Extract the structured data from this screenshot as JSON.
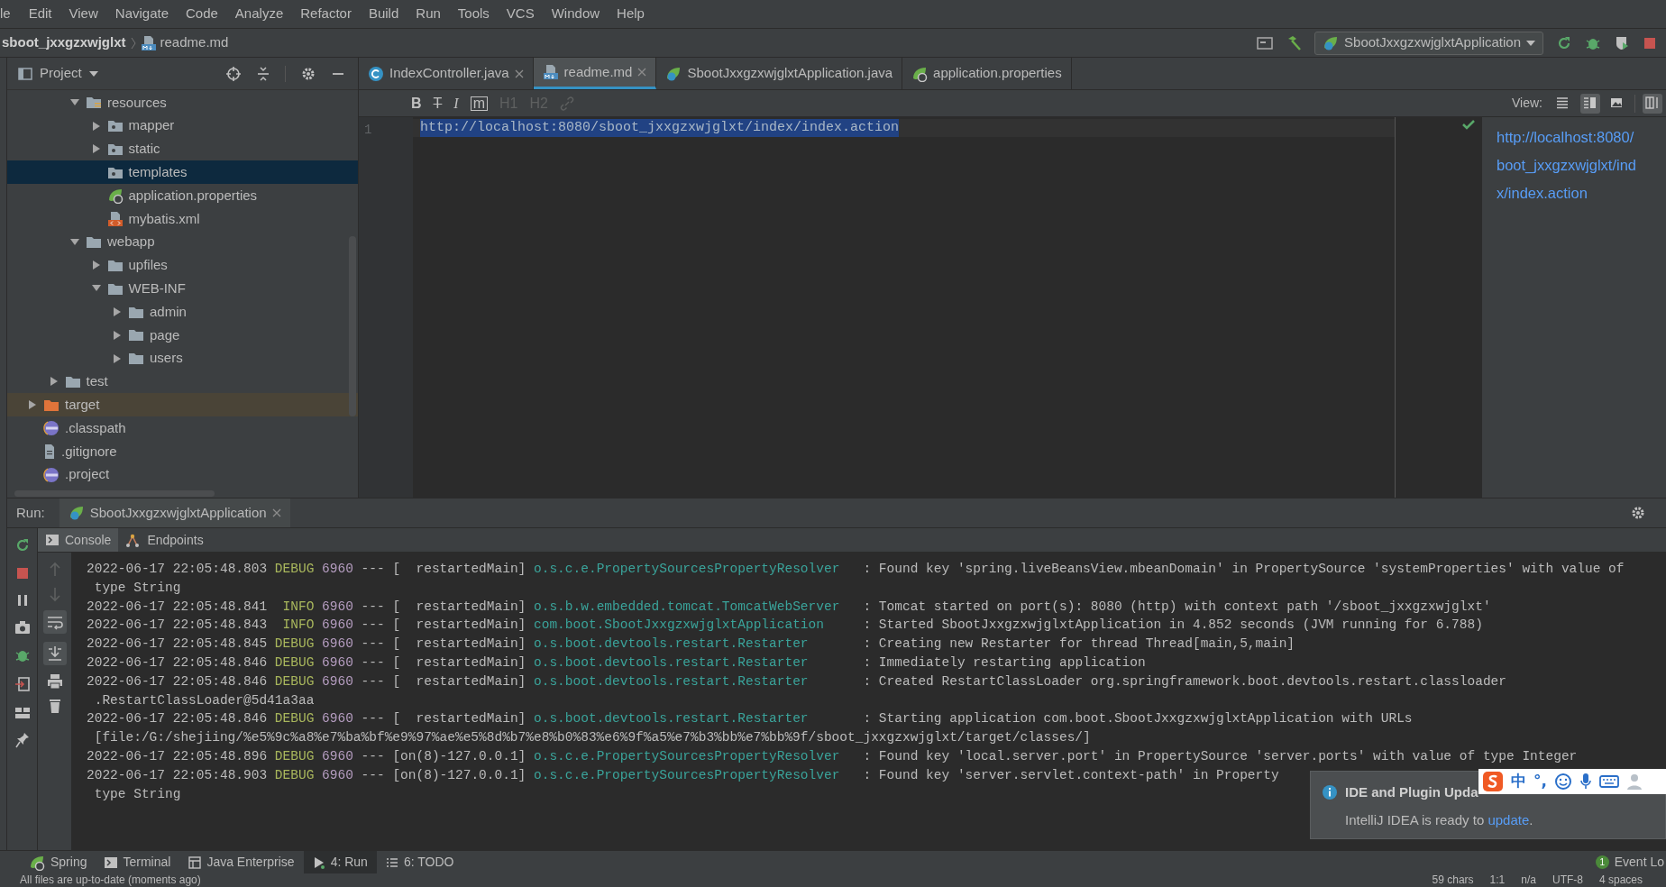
{
  "menu": [
    "le",
    "Edit",
    "View",
    "Navigate",
    "Code",
    "Analyze",
    "Refactor",
    "Build",
    "Run",
    "Tools",
    "VCS",
    "Window",
    "Help"
  ],
  "breadcrumbs": [
    {
      "label": "sboot_jxxgzxwjglxt",
      "kind": "project"
    },
    {
      "label": "readme.md",
      "kind": "markdown"
    }
  ],
  "run_config": {
    "label": "SbootJxxgzxwjglxtApplication"
  },
  "project_panel": {
    "title": "Project",
    "tree": [
      {
        "children": [
          {
            "children": [
              {
                "name": "resources",
                "kind": "resources_folder",
                "expanded": true,
                "selected": false,
                "children": [
                  {
                    "name": "mapper",
                    "kind": "source_folder",
                    "expanded": false,
                    "selected": false
                  },
                  {
                    "name": "static",
                    "kind": "source_folder",
                    "expanded": false,
                    "selected": false
                  },
                  {
                    "name": "templates",
                    "kind": "source_folder",
                    "selected": true
                  },
                  {
                    "name": "application.properties",
                    "kind": "spring",
                    "selected": false
                  },
                  {
                    "name": "mybatis.xml",
                    "kind": "xml",
                    "selected": false
                  }
                ]
              },
              {
                "name": "webapp",
                "kind": "folder",
                "expanded": true,
                "selected": false,
                "children": [
                  {
                    "name": "upfiles",
                    "kind": "folder",
                    "expanded": false,
                    "selected": false
                  },
                  {
                    "name": "WEB-INF",
                    "kind": "folder",
                    "expanded": true,
                    "selected": false,
                    "children": [
                      {
                        "name": "admin",
                        "kind": "folder",
                        "expanded": false,
                        "selected": false
                      },
                      {
                        "name": "page",
                        "kind": "folder",
                        "expanded": false,
                        "selected": false
                      },
                      {
                        "name": "users",
                        "kind": "folder",
                        "expanded": false,
                        "selected": false
                      }
                    ]
                  }
                ]
              }
            ]
          },
          {
            "name": "test",
            "kind": "folder",
            "expanded": false,
            "selected": false
          }
        ]
      },
      {
        "name": "target",
        "kind": "excluded_folder",
        "expanded": false,
        "selected": false
      },
      {
        "name": ".classpath",
        "kind": "eclipse",
        "selected": false
      },
      {
        "name": ".gitignore",
        "kind": "file",
        "selected": false
      },
      {
        "name": ".project",
        "kind": "eclipse",
        "selected": false
      }
    ]
  },
  "editor_tabs": [
    {
      "label": "IndexController.java",
      "kind": "java_class",
      "selected": false,
      "closable": true
    },
    {
      "label": "readme.md",
      "kind": "markdown",
      "selected": true,
      "closable": true
    },
    {
      "label": "SbootJxxgzxwjglxtApplication.java",
      "kind": "spring_app",
      "selected": false,
      "closable": false
    },
    {
      "label": "application.properties",
      "kind": "spring",
      "selected": false,
      "closable": false
    }
  ],
  "format_buttons": [
    {
      "label": "B",
      "kind": "bold",
      "disabled": false
    },
    {
      "label": "T",
      "kind": "strike",
      "disabled": false
    },
    {
      "label": "I",
      "kind": "italic",
      "disabled": false
    },
    {
      "label": "m",
      "kind": "code",
      "disabled": false
    },
    {
      "label": "H1",
      "kind": "heading",
      "disabled": true
    },
    {
      "label": "H2",
      "kind": "heading",
      "disabled": true
    },
    {
      "kind": "link",
      "disabled": true
    }
  ],
  "view_label": "View:",
  "view_modes": [
    {
      "kind": "editor",
      "selected": false
    },
    {
      "kind": "split",
      "selected": true
    },
    {
      "kind": "preview",
      "selected": false
    },
    {
      "kind": "layout",
      "selected": true
    }
  ],
  "editor": {
    "lines": [
      {
        "number": "1",
        "text": "http://localhost:8080/sboot_jxxgzxwjglxt/index/index.action",
        "selected": true
      }
    ]
  },
  "preview": {
    "lines": [
      "http://localhost:8080/",
      "boot_jxxgzxwjglxt/ind",
      "x/index.action"
    ]
  },
  "run_panel": {
    "label": "Run:",
    "tab": "SbootJxxgzxwjglxtApplication",
    "console_tabs": [
      {
        "label": "Console",
        "kind": "console",
        "selected": true
      },
      {
        "label": "Endpoints",
        "kind": "endpoints",
        "selected": false
      }
    ],
    "log": [
      {
        "kind": "entry",
        "date": "2022-06-17 22:05:48.803",
        "level": "DEBUG",
        "pid": "6960",
        "sep": "---",
        "thread": "[  restartedMain]",
        "logger": "o.s.c.e.PropertySourcesPropertyResolver",
        "message": ": Found key 'spring.liveBeansView.mbeanDomain' in PropertySource 'systemProperties' with value of"
      },
      {
        "kind": "continuation",
        "text": "type String"
      },
      {
        "kind": "entry",
        "date": "2022-06-17 22:05:48.841",
        "level": "INFO",
        "pid": "6960",
        "sep": "---",
        "thread": "[  restartedMain]",
        "logger": "o.s.b.w.embedded.tomcat.TomcatWebServer",
        "message": ": Tomcat started on port(s): 8080 (http) with context path '/sboot_jxxgzxwjglxt'"
      },
      {
        "kind": "entry",
        "date": "2022-06-17 22:05:48.843",
        "level": "INFO",
        "pid": "6960",
        "sep": "---",
        "thread": "[  restartedMain]",
        "logger": "com.boot.SbootJxxgzxwjglxtApplication",
        "message": ": Started SbootJxxgzxwjglxtApplication in 4.852 seconds (JVM running for 6.788)"
      },
      {
        "kind": "entry",
        "date": "2022-06-17 22:05:48.845",
        "level": "DEBUG",
        "pid": "6960",
        "sep": "---",
        "thread": "[  restartedMain]",
        "logger": "o.s.boot.devtools.restart.Restarter",
        "message": ": Creating new Restarter for thread Thread[main,5,main]"
      },
      {
        "kind": "entry",
        "date": "2022-06-17 22:05:48.846",
        "level": "DEBUG",
        "pid": "6960",
        "sep": "---",
        "thread": "[  restartedMain]",
        "logger": "o.s.boot.devtools.restart.Restarter",
        "message": ": Immediately restarting application"
      },
      {
        "kind": "entry",
        "date": "2022-06-17 22:05:48.846",
        "level": "DEBUG",
        "pid": "6960",
        "sep": "---",
        "thread": "[  restartedMain]",
        "logger": "o.s.boot.devtools.restart.Restarter",
        "message": ": Created RestartClassLoader org.springframework.boot.devtools.restart.classloader"
      },
      {
        "kind": "continuation",
        "text": ".RestartClassLoader@5d41a3aa"
      },
      {
        "kind": "entry",
        "date": "2022-06-17 22:05:48.846",
        "level": "DEBUG",
        "pid": "6960",
        "sep": "---",
        "thread": "[  restartedMain]",
        "logger": "o.s.boot.devtools.restart.Restarter",
        "message": ": Starting application com.boot.SbootJxxgzxwjglxtApplication with URLs"
      },
      {
        "kind": "continuation",
        "text": "[file:/G:/shejiing/%e5%9c%a8%e7%ba%bf%e9%97%ae%e5%8d%b7%e8%b0%83%e6%9f%a5%e7%b3%bb%e7%bb%9f/sboot_jxxgzxwjglxt/target/classes/]"
      },
      {
        "kind": "entry",
        "date": "2022-06-17 22:05:48.896",
        "level": "DEBUG",
        "pid": "6960",
        "sep": "---",
        "thread": "[on(8)-127.0.0.1]",
        "logger": "o.s.c.e.PropertySourcesPropertyResolver",
        "message": ": Found key 'local.server.port' in PropertySource 'server.ports' with value of type Integer"
      },
      {
        "kind": "entry",
        "date": "2022-06-17 22:05:48.903",
        "level": "DEBUG",
        "pid": "6960",
        "sep": "---",
        "thread": "[on(8)-127.0.0.1]",
        "logger": "o.s.c.e.PropertySourcesPropertyResolver",
        "message": ": Found key 'server.servlet.context-path' in Property"
      },
      {
        "kind": "continuation",
        "text": "type String"
      }
    ]
  },
  "notification": {
    "title": "IDE and Plugin Upda",
    "message": "IntelliJ IDEA is ready to ",
    "link": "update",
    "suffix": "."
  },
  "ime_toolbar": {
    "items": [
      "中",
      "°,"
    ]
  },
  "tool_windows": [
    {
      "label": "Spring",
      "kind": "spring",
      "selected": false
    },
    {
      "label": "Terminal",
      "kind": "terminal",
      "selected": false
    },
    {
      "label": "Java Enterprise",
      "kind": "enterprise",
      "selected": false
    },
    {
      "label": "4: Run",
      "kind": "run",
      "selected": true
    },
    {
      "label": "6: TODO",
      "kind": "todo",
      "selected": false
    }
  ],
  "event_log": {
    "count": "1",
    "label": "Event Lo"
  },
  "status_bar": {
    "message": "All files are up-to-date (moments ago)",
    "items": [
      "59 chars",
      "1:1",
      "n/a",
      "UTF-8",
      "4 spaces"
    ]
  }
}
